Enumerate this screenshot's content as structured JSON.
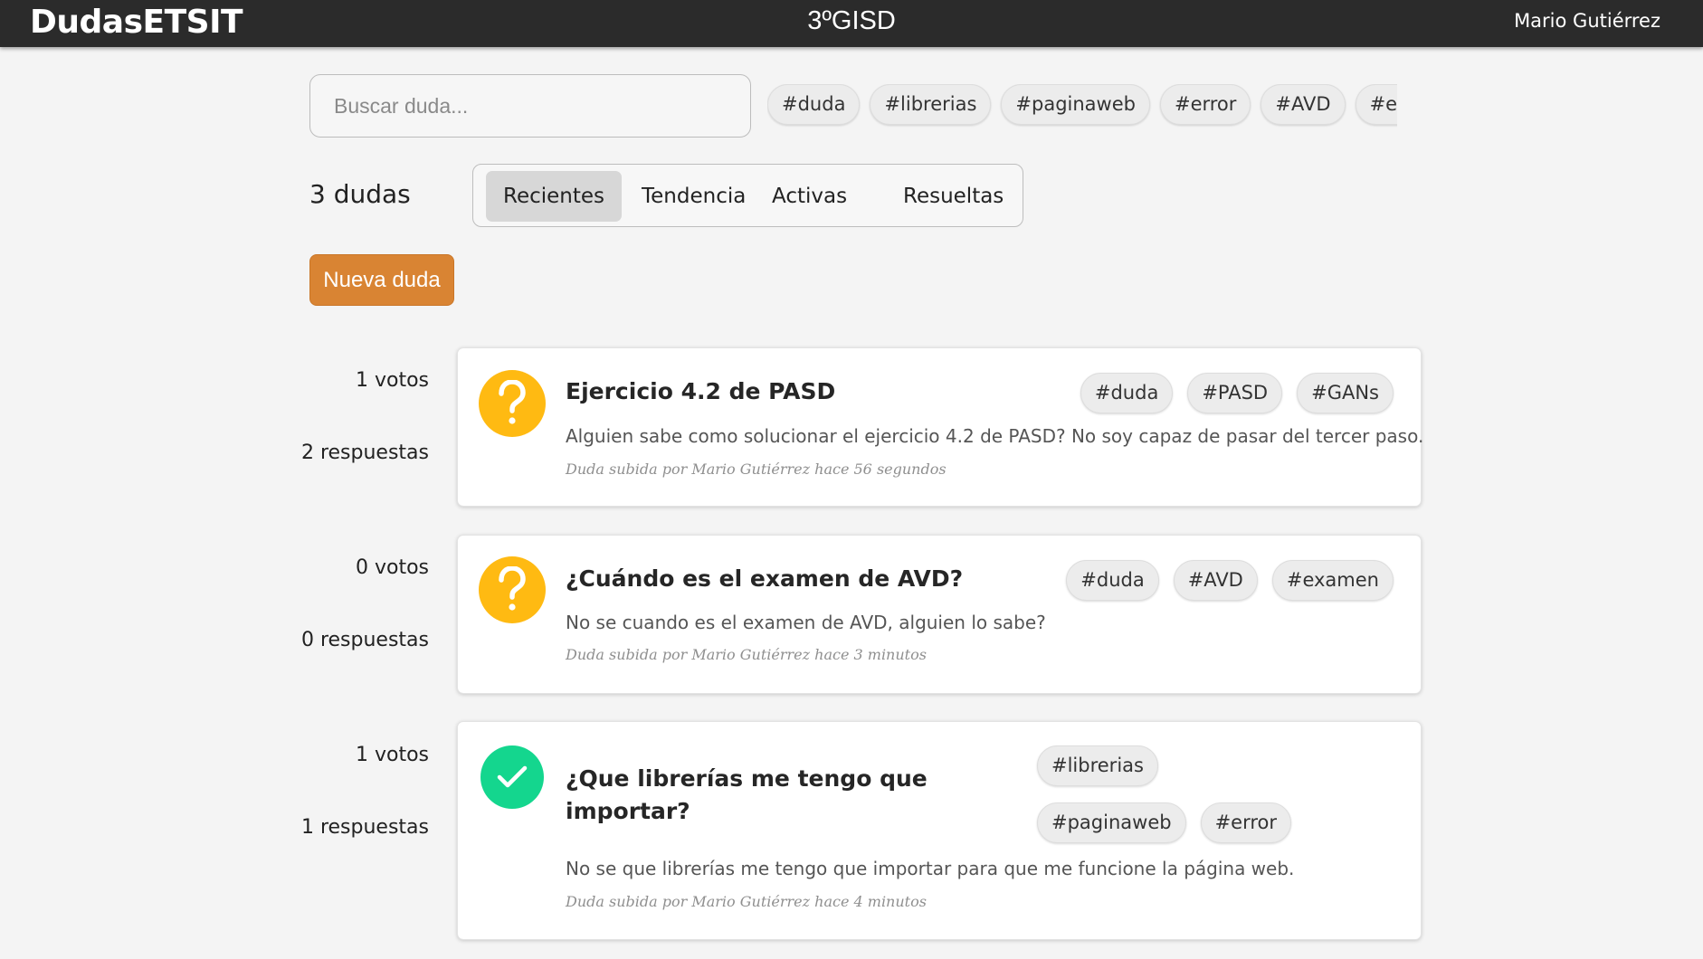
{
  "header": {
    "brand": "DudasETSIT",
    "course": "3ºGISD",
    "user": "Mario Gutiérrez"
  },
  "search": {
    "placeholder": "Buscar duda...",
    "value": ""
  },
  "filter_tags": [
    "#duda",
    "#librerias",
    "#paginaweb",
    "#error",
    "#AVD",
    "#examen"
  ],
  "summary": {
    "count_label": "3 dudas"
  },
  "tabs": [
    {
      "label": "Recientes",
      "active": true
    },
    {
      "label": "Tendencia",
      "active": false
    },
    {
      "label": "Activas",
      "active": false
    },
    {
      "label": "Resueltas",
      "active": false
    }
  ],
  "new_button": {
    "label": "Nueva duda",
    "color": "#d98433"
  },
  "questions": [
    {
      "votes": "1 votos",
      "answers": "2 respuestas",
      "status": "open",
      "status_icon": "question-mark-icon",
      "title": "Ejercicio 4.2 de PASD",
      "body": "Alguien sabe como solucionar el ejercicio 4.2 de PASD? No soy capaz de pasar del tercer paso.",
      "meta": "Duda subida por Mario Gutiérrez hace 56 segundos",
      "tags": [
        "#duda",
        "#PASD",
        "#GANs"
      ]
    },
    {
      "votes": "0 votos",
      "answers": "0 respuestas",
      "status": "open",
      "status_icon": "question-mark-icon",
      "title": "¿Cuándo es el examen de AVD?",
      "body": "No se cuando es el examen de AVD, alguien lo sabe?",
      "meta": "Duda subida por Mario Gutiérrez hace 3 minutos",
      "tags": [
        "#duda",
        "#AVD",
        "#examen"
      ]
    },
    {
      "votes": "1 votos",
      "answers": "1 respuestas",
      "status": "solved",
      "status_icon": "checkmark-icon",
      "title": "¿Que librerías me tengo que importar?",
      "body": "No se que librerías me tengo que importar para que me funcione la página web.",
      "meta": "Duda subida por Mario Gutiérrez hace 4 minutos",
      "tags": [
        "#librerias",
        "#paginaweb",
        "#error"
      ]
    }
  ],
  "colors": {
    "topbar": "#2b2b2b",
    "open_status": "#ffba12",
    "solved_status": "#14d68e",
    "accent": "#d98433"
  }
}
